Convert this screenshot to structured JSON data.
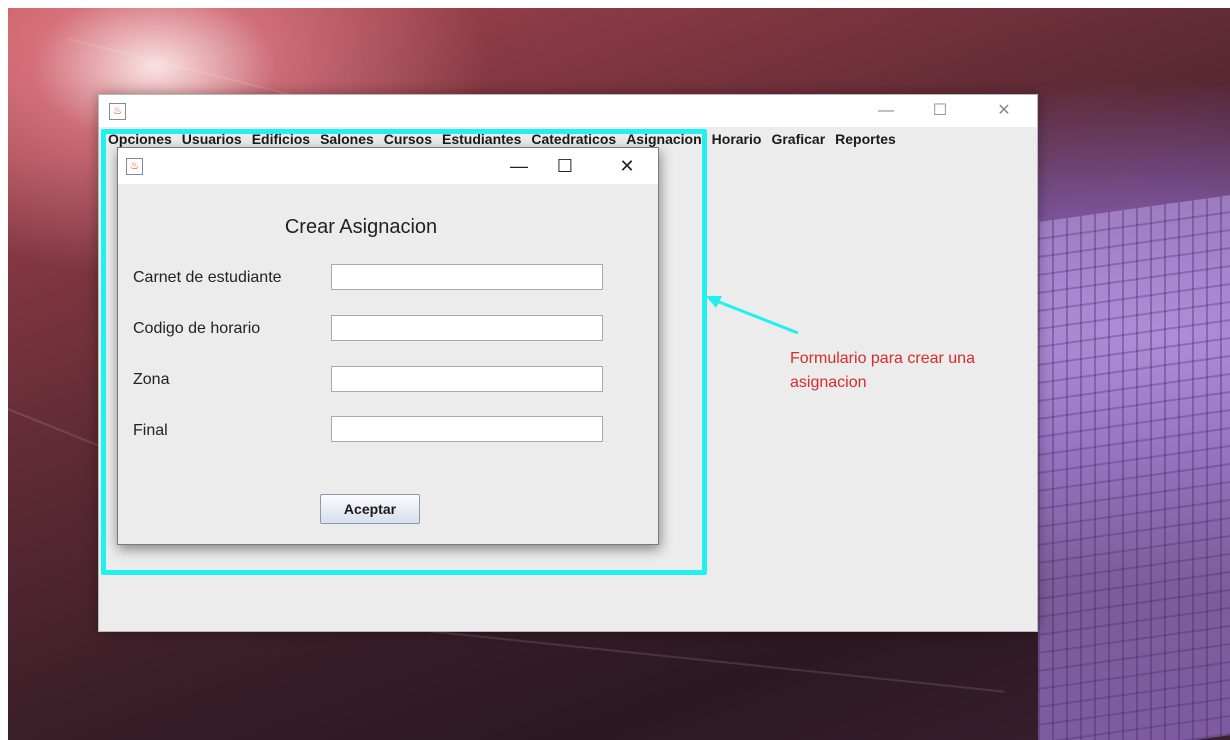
{
  "main_window": {
    "menu": [
      "Opciones",
      "Usuarios",
      "Edificios",
      "Salones",
      "Cursos",
      "Estudiantes",
      "Catedraticos",
      "Asignacion",
      "Horario",
      "Graficar",
      "Reportes"
    ],
    "controls": {
      "minimize": "—",
      "maximize": "☐",
      "close": "✕"
    }
  },
  "dialog": {
    "heading": "Crear Asignacion",
    "controls": {
      "minimize": "—",
      "maximize": "☐",
      "close": "✕"
    },
    "fields": [
      {
        "label": "Carnet de estudiante",
        "value": ""
      },
      {
        "label": "Codigo de horario",
        "value": ""
      },
      {
        "label": "Zona",
        "value": ""
      },
      {
        "label": "Final",
        "value": ""
      }
    ],
    "accept_label": "Aceptar"
  },
  "annotation": {
    "text": "Formulario para crear una asignacion",
    "highlight_color": "#1ff0f0",
    "text_color": "#d82b2b"
  },
  "icons": [
    "java-app-icon",
    "arrow-icon"
  ]
}
